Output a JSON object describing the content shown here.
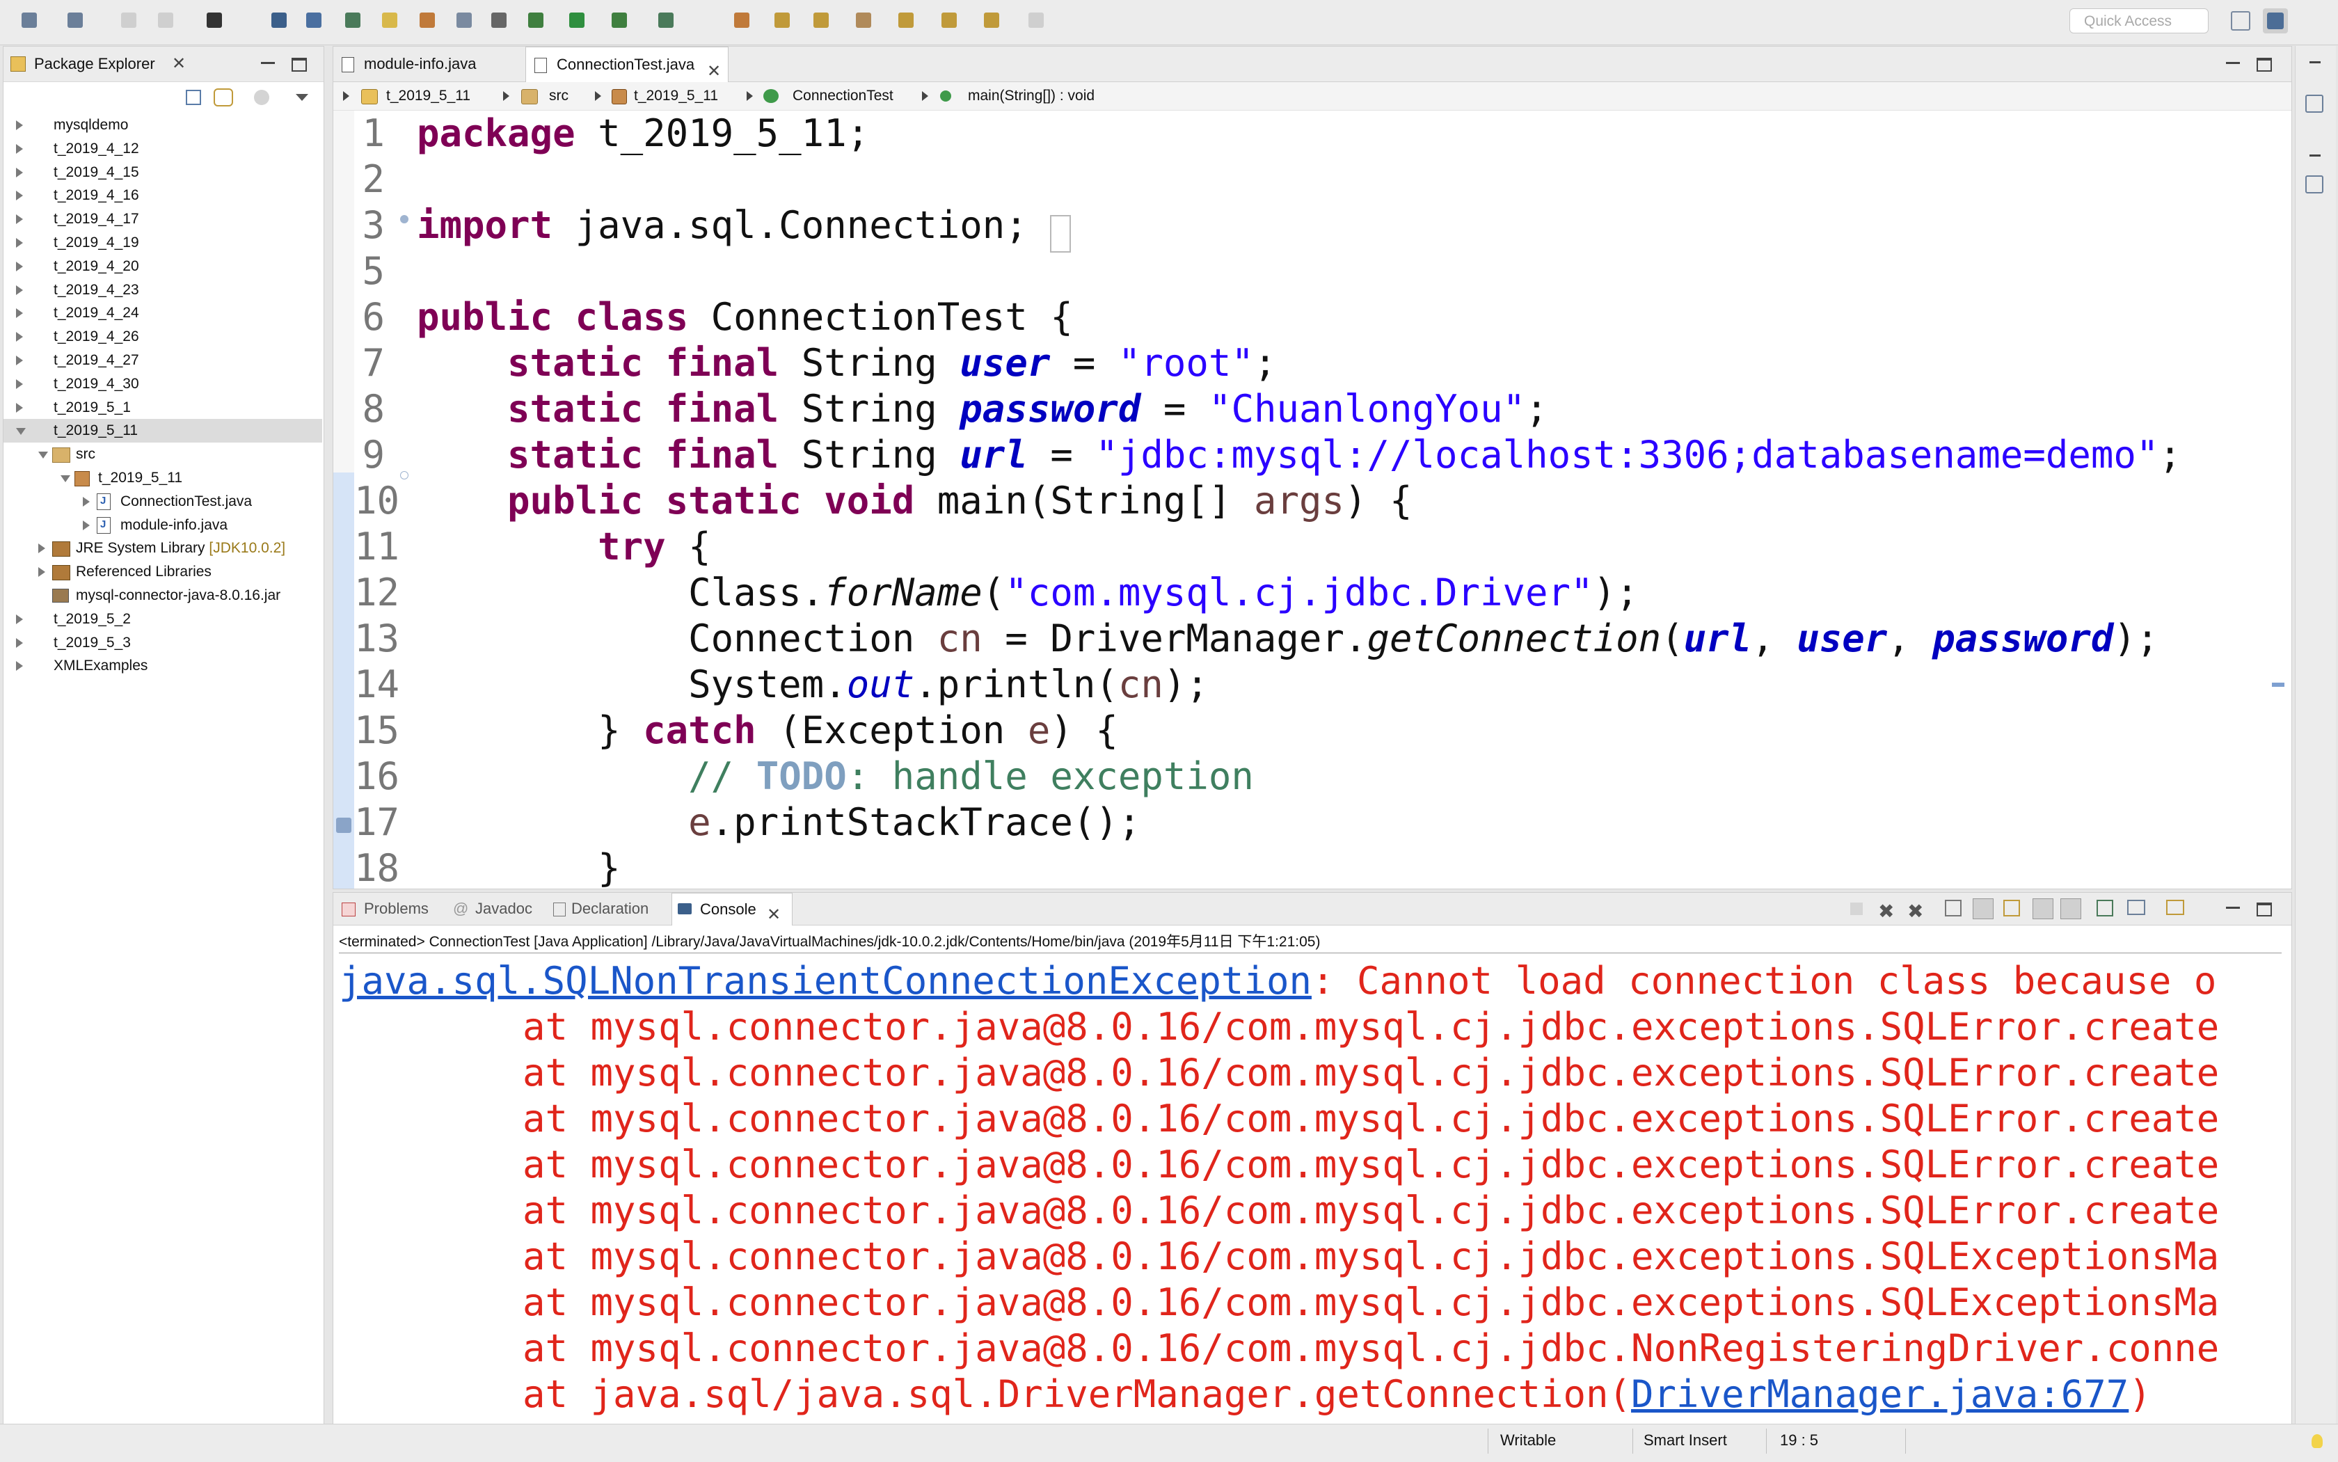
{
  "toolbar": {
    "quick_access_placeholder": "Quick Access",
    "icons": [
      "new-icon",
      "new-java-icon",
      "save-icon",
      "save-all-icon",
      "user-icon",
      "terminal-icon",
      "select-icon",
      "filter-icon",
      "pen-icon",
      "build-icon",
      "refactor-icon",
      "pilcrow-icon",
      "debug-icon",
      "run-icon",
      "run-external-icon",
      "coverage-icon",
      "new-package-icon",
      "open-type-icon",
      "open-folder-icon",
      "search-icon",
      "next-annotation-icon",
      "prev-annotation-icon",
      "back-icon",
      "forward-icon"
    ]
  },
  "package_explorer": {
    "title": "Package Explorer",
    "tree": [
      {
        "label": "mysqldemo",
        "icon": "project",
        "expanded": false
      },
      {
        "label": "t_2019_4_12",
        "icon": "project",
        "expanded": false
      },
      {
        "label": "t_2019_4_15",
        "icon": "project",
        "expanded": false
      },
      {
        "label": "t_2019_4_16",
        "icon": "project",
        "expanded": false
      },
      {
        "label": "t_2019_4_17",
        "icon": "project",
        "expanded": false
      },
      {
        "label": "t_2019_4_19",
        "icon": "project",
        "expanded": false
      },
      {
        "label": "t_2019_4_20",
        "icon": "project",
        "expanded": false
      },
      {
        "label": "t_2019_4_23",
        "icon": "project",
        "expanded": false
      },
      {
        "label": "t_2019_4_24",
        "icon": "project",
        "expanded": false
      },
      {
        "label": "t_2019_4_26",
        "icon": "project",
        "expanded": false
      },
      {
        "label": "t_2019_4_27",
        "icon": "project",
        "expanded": false
      },
      {
        "label": "t_2019_4_30",
        "icon": "project",
        "expanded": false
      },
      {
        "label": "t_2019_5_1",
        "icon": "project",
        "expanded": false
      },
      {
        "label": "t_2019_5_11",
        "icon": "project",
        "expanded": true,
        "selected": true
      },
      {
        "label": "src",
        "icon": "src",
        "expanded": true
      },
      {
        "label": "t_2019_5_11",
        "icon": "pkg",
        "expanded": true
      },
      {
        "label": "ConnectionTest.java",
        "icon": "java",
        "expanded": false
      },
      {
        "label": "module-info.java",
        "icon": "java",
        "expanded": false
      },
      {
        "label": "JRE System Library",
        "decoration": "[JDK10.0.2]",
        "icon": "lib",
        "expanded": false
      },
      {
        "label": "Referenced Libraries",
        "icon": "lib",
        "expanded": false
      },
      {
        "label": "mysql-connector-java-8.0.16.jar",
        "icon": "jar",
        "expanded": null
      },
      {
        "label": "t_2019_5_2",
        "icon": "project",
        "expanded": false
      },
      {
        "label": "t_2019_5_3",
        "icon": "project",
        "expanded": false
      },
      {
        "label": "XMLExamples",
        "icon": "project",
        "expanded": false
      }
    ]
  },
  "editor": {
    "tabs": [
      {
        "label": "module-info.java",
        "active": false
      },
      {
        "label": "ConnectionTest.java",
        "active": true
      }
    ],
    "breadcrumb": [
      "t_2019_5_11",
      "src",
      "t_2019_5_11",
      "ConnectionTest",
      "main(String[]) : void"
    ],
    "code_lines": [
      {
        "n": "1",
        "segs": [
          [
            "k",
            "package"
          ],
          [
            "n",
            " t_2019_5_11;"
          ]
        ]
      },
      {
        "n": "2",
        "segs": []
      },
      {
        "n": "3",
        "segs": [
          [
            "k",
            "import"
          ],
          [
            "n",
            " java.sql.Connection;"
          ]
        ]
      },
      {
        "n": "5",
        "segs": []
      },
      {
        "n": "6",
        "segs": [
          [
            "k",
            "public"
          ],
          [
            "n",
            " "
          ],
          [
            "k",
            "class"
          ],
          [
            "n",
            " ConnectionTest {"
          ]
        ]
      },
      {
        "n": "7",
        "segs": [
          [
            "n",
            "    "
          ],
          [
            "k",
            "static"
          ],
          [
            "n",
            " "
          ],
          [
            "k",
            "final"
          ],
          [
            "n",
            " String "
          ],
          [
            "f",
            "user"
          ],
          [
            "n",
            " = "
          ],
          [
            "s",
            "\"root\""
          ],
          [
            "n",
            ";"
          ]
        ]
      },
      {
        "n": "8",
        "segs": [
          [
            "n",
            "    "
          ],
          [
            "k",
            "static"
          ],
          [
            "n",
            " "
          ],
          [
            "k",
            "final"
          ],
          [
            "n",
            " String "
          ],
          [
            "f",
            "password"
          ],
          [
            "n",
            " = "
          ],
          [
            "s",
            "\"ChuanlongYou\""
          ],
          [
            "n",
            ";"
          ]
        ]
      },
      {
        "n": "9",
        "segs": [
          [
            "n",
            "    "
          ],
          [
            "k",
            "static"
          ],
          [
            "n",
            " "
          ],
          [
            "k",
            "final"
          ],
          [
            "n",
            " String "
          ],
          [
            "f",
            "url"
          ],
          [
            "n",
            " = "
          ],
          [
            "s",
            "\"jdbc:mysql://localhost:3306;databasename=demo\""
          ],
          [
            "n",
            ";"
          ]
        ]
      },
      {
        "n": "10",
        "segs": [
          [
            "n",
            "    "
          ],
          [
            "k",
            "public"
          ],
          [
            "n",
            " "
          ],
          [
            "k",
            "static"
          ],
          [
            "n",
            " "
          ],
          [
            "k",
            "void"
          ],
          [
            "n",
            " main(String[] "
          ],
          [
            "p",
            "args"
          ],
          [
            "n",
            ") {"
          ]
        ]
      },
      {
        "n": "11",
        "segs": [
          [
            "n",
            "        "
          ],
          [
            "k",
            "try"
          ],
          [
            "n",
            " {"
          ]
        ]
      },
      {
        "n": "12",
        "segs": [
          [
            "n",
            "            Class."
          ],
          [
            "i",
            "forName"
          ],
          [
            "n",
            "("
          ],
          [
            "s",
            "\"com.mysql.cj.jdbc.Driver\""
          ],
          [
            "n",
            ");"
          ]
        ]
      },
      {
        "n": "13",
        "segs": [
          [
            "n",
            "            Connection "
          ],
          [
            "p",
            "cn"
          ],
          [
            "n",
            " = DriverManager."
          ],
          [
            "i",
            "getConnection"
          ],
          [
            "n",
            "("
          ],
          [
            "f",
            "url"
          ],
          [
            "n",
            ", "
          ],
          [
            "f",
            "user"
          ],
          [
            "n",
            ", "
          ],
          [
            "f",
            "password"
          ],
          [
            "n",
            ");"
          ]
        ]
      },
      {
        "n": "14",
        "segs": [
          [
            "n",
            "            System."
          ],
          [
            "so",
            "out"
          ],
          [
            "n",
            ".println("
          ],
          [
            "p",
            "cn"
          ],
          [
            "n",
            ");"
          ]
        ]
      },
      {
        "n": "15",
        "segs": [
          [
            "n",
            "        } "
          ],
          [
            "k",
            "catch"
          ],
          [
            "n",
            " (Exception "
          ],
          [
            "p",
            "e"
          ],
          [
            "n",
            ") {"
          ]
        ]
      },
      {
        "n": "16",
        "segs": [
          [
            "n",
            "            "
          ],
          [
            "cm",
            "// "
          ],
          [
            "todo",
            "TODO"
          ],
          [
            "cm",
            ": handle exception"
          ]
        ]
      },
      {
        "n": "17",
        "segs": [
          [
            "n",
            "            "
          ],
          [
            "p",
            "e"
          ],
          [
            "n",
            ".printStackTrace();"
          ]
        ]
      },
      {
        "n": "18",
        "segs": [
          [
            "n",
            "        }"
          ]
        ]
      }
    ]
  },
  "console": {
    "tabs": [
      {
        "label": "Problems",
        "active": false
      },
      {
        "label": "Javadoc",
        "active": false
      },
      {
        "label": "Declaration",
        "active": false
      },
      {
        "label": "Console",
        "active": true
      }
    ],
    "status": "<terminated> ConnectionTest [Java Application] /Library/Java/JavaVirtualMachines/jdk-10.0.2.jdk/Contents/Home/bin/java (2019年5月11日 下午1:21:05)",
    "lines": [
      {
        "link": "java.sql.SQLNonTransientConnectionException",
        "text": ": Cannot load connection class because o",
        "indent": false
      },
      {
        "text": "at mysql.connector.java@8.0.16/com.mysql.cj.jdbc.exceptions.SQLError.create",
        "indent": true
      },
      {
        "text": "at mysql.connector.java@8.0.16/com.mysql.cj.jdbc.exceptions.SQLError.create",
        "indent": true
      },
      {
        "text": "at mysql.connector.java@8.0.16/com.mysql.cj.jdbc.exceptions.SQLError.create",
        "indent": true
      },
      {
        "text": "at mysql.connector.java@8.0.16/com.mysql.cj.jdbc.exceptions.SQLError.create",
        "indent": true
      },
      {
        "text": "at mysql.connector.java@8.0.16/com.mysql.cj.jdbc.exceptions.SQLError.create",
        "indent": true
      },
      {
        "text": "at mysql.connector.java@8.0.16/com.mysql.cj.jdbc.exceptions.SQLExceptionsMa",
        "indent": true
      },
      {
        "text": "at mysql.connector.java@8.0.16/com.mysql.cj.jdbc.exceptions.SQLExceptionsMa",
        "indent": true
      },
      {
        "text": "at mysql.connector.java@8.0.16/com.mysql.cj.jdbc.NonRegisteringDriver.conne",
        "indent": true
      },
      {
        "text": "at java.sql/java.sql.DriverManager.getConnection(",
        "link": "DriverManager.java:677",
        "tail": ")",
        "indent": true
      }
    ]
  },
  "status_bar": {
    "mode": "Writable",
    "insert_mode": "Smart Insert",
    "position": "19 : 5"
  }
}
